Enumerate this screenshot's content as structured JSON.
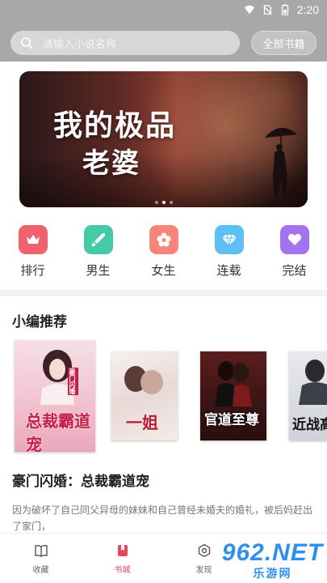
{
  "status": {
    "time": "2:20"
  },
  "header": {
    "search_placeholder": "请输入小说名称",
    "all_books": "全部书籍"
  },
  "banner": {
    "line1": "我的极品",
    "line2": "老婆",
    "dots": 3,
    "active_dot": 2
  },
  "categories": [
    {
      "label": "排行",
      "icon": "crown-icon",
      "color": "#f0626e"
    },
    {
      "label": "男生",
      "icon": "sword-icon",
      "color": "#46c9a6"
    },
    {
      "label": "女生",
      "icon": "flower-icon",
      "color": "#f7857b"
    },
    {
      "label": "连载",
      "icon": "diamond-icon",
      "color": "#5dbff3"
    },
    {
      "label": "完结",
      "icon": "heart-icon",
      "color": "#a474f0"
    }
  ],
  "section_title": "小编推荐",
  "books": [
    {
      "title": "总裁霸道宠",
      "badge": "豪门闪婚"
    },
    {
      "title": "一姐"
    },
    {
      "title": "官道至尊"
    },
    {
      "title": "近战高"
    }
  ],
  "featured": {
    "title": "豪门闪婚：总裁霸道宠",
    "description": "因为破坏了自己同父异母的妹妹和自己曾经未婚夫的婚礼，被后妈赶出了家门，"
  },
  "nav": [
    {
      "label": "收藏",
      "icon": "book-open-icon"
    },
    {
      "label": "书城",
      "icon": "bookmark-icon",
      "active": true
    },
    {
      "label": "发现",
      "icon": "compass-icon"
    }
  ],
  "watermark": {
    "brand": "962.NET",
    "sub": "乐游网"
  }
}
